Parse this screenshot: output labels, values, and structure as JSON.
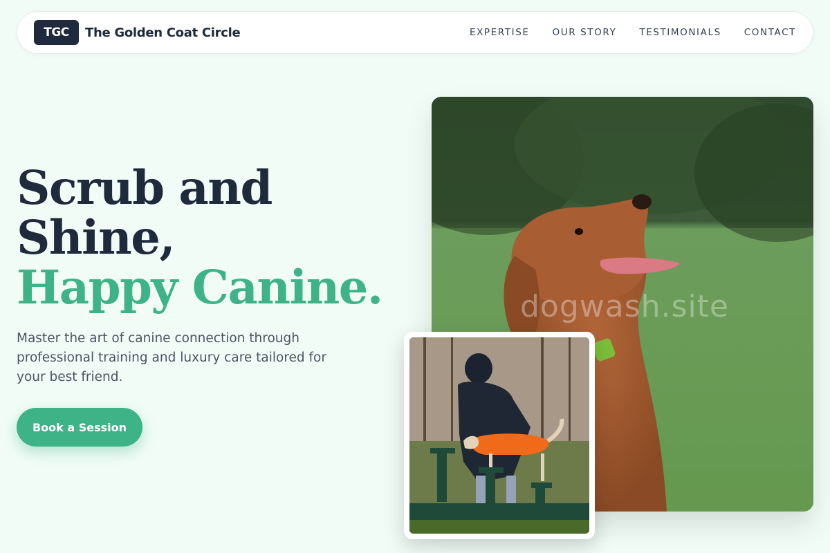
{
  "nav": {
    "badge": "TGC",
    "brand_name": "The Golden Coat Circle",
    "links": [
      "EXPERTISE",
      "OUR STORY",
      "TESTIMONIALS",
      "CONTACT"
    ]
  },
  "hero": {
    "headline_line1": "Scrub and",
    "headline_line2": "Shine,",
    "headline_line3": "Happy Canine.",
    "subtext": "Master the art of canine connection through professional training and luxury care tailored for your best friend.",
    "cta_label": "Book a Session"
  },
  "images": {
    "main_alt": "Golden retriever-like dog with tongue out in a grassy field",
    "main_watermark": "dogwash.site",
    "secondary_alt": "Person in black jacket training a dog in an orange coat on a wooden bench"
  },
  "colors": {
    "background": "#f1fcf7",
    "accent": "#3fb388",
    "dark": "#1f2a3c"
  }
}
